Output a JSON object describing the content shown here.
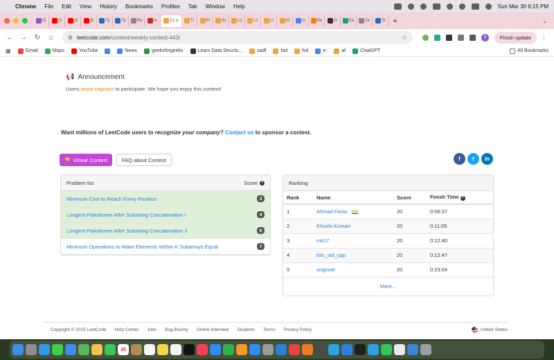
{
  "menubar": {
    "app": "Chrome",
    "items": [
      "File",
      "Edit",
      "View",
      "History",
      "Bookmarks",
      "Profiles",
      "Tab",
      "Window",
      "Help"
    ],
    "clock": "Sun Mar 30  6:15 PM"
  },
  "tabs": [
    {
      "label": "Gi",
      "color": "#7b5cd6"
    },
    {
      "label": "(3",
      "color": "#ff0000"
    },
    {
      "label": "(6",
      "color": "#ff0000"
    },
    {
      "label": "(6",
      "color": "#ff0000"
    },
    {
      "label": "Ty",
      "color": "#1f6fb2"
    },
    {
      "label": "Ty",
      "color": "#1f6fb2"
    },
    {
      "label": "Re",
      "color": "#888888"
    },
    {
      "label": "m",
      "color": "#c62828"
    },
    {
      "label": "Cc",
      "color": "#f0a23b",
      "active": true
    },
    {
      "label": "Tl",
      "color": "#f0a23b"
    },
    {
      "label": "Pr",
      "color": "#f0a23b"
    },
    {
      "label": "Sc",
      "color": "#f0a23b"
    },
    {
      "label": "Lc",
      "color": "#f0a23b"
    },
    {
      "label": "Lc",
      "color": "#f0a23b"
    },
    {
      "label": "Lt",
      "color": "#f0a23b"
    },
    {
      "label": "M",
      "color": "#f0a23b"
    },
    {
      "label": "In",
      "color": "#4285f4"
    },
    {
      "label": "Re",
      "color": "#f57c00"
    },
    {
      "label": "G",
      "color": "#333333"
    },
    {
      "label": "Ea",
      "color": "#10a37f"
    },
    {
      "label": "Ze",
      "color": "#888888"
    },
    {
      "label": "Sl",
      "color": "#1f6fb2"
    }
  ],
  "address": {
    "host": "leetcode.com",
    "path": "/contest/weekly-contest-443/"
  },
  "toolbar": {
    "finish_update": "Finish update"
  },
  "bookmarks": [
    {
      "label": "Gmail",
      "color": "#ea4335"
    },
    {
      "label": "Maps",
      "color": "#34a853"
    },
    {
      "label": "YouTube",
      "color": "#ff0000"
    },
    {
      "label": "",
      "color": "#4285f4"
    },
    {
      "label": "News",
      "color": "#4285f4"
    },
    {
      "label": "geeksforgeeks",
      "color": "#2f8d46"
    },
    {
      "label": "Learn Data Structu...",
      "color": "#333333"
    },
    {
      "label": "sadf",
      "color": "#f0a23b"
    },
    {
      "label": "fad",
      "color": "#f0a23b"
    },
    {
      "label": "fsd",
      "color": "#f0a23b"
    },
    {
      "label": "e;",
      "color": "#4285f4"
    },
    {
      "label": "af",
      "color": "#f0a23b"
    },
    {
      "label": "ChatGPT",
      "color": "#10a37f"
    }
  ],
  "all_bookmarks": "All Bookmarks",
  "announcement": {
    "title": "Announcement",
    "text_before": "Users ",
    "link": "must register",
    "text_after": " to participate. We hope you enjoy this contest!"
  },
  "sponsor": {
    "part1": "Want millions of LeetCode users to ",
    "emph": "recognize your company",
    "part2": "? ",
    "link": "Contact us",
    "part3": " to sponsor a contest."
  },
  "buttons": {
    "virtual_em": "Virtual",
    "virtual_rest": " Contest",
    "faq": "FAQ about Contest"
  },
  "social": [
    {
      "icon": "f",
      "color": "#3b5998"
    },
    {
      "icon": "t",
      "color": "#1da1f2"
    },
    {
      "icon": "in",
      "color": "#0077b5"
    }
  ],
  "problem_list": {
    "header": "Problem list",
    "score_header": "Score",
    "items": [
      {
        "title": "Minimum Cost to Reach Every Position",
        "score": "3",
        "solved": true
      },
      {
        "title": "Longest Palindrome After Substring Concatenation I",
        "score": "4",
        "solved": true
      },
      {
        "title": "Longest Palindrome After Substring Concatenation II",
        "score": "6",
        "solved": true
      },
      {
        "title": "Minimum Operations to Make Elements Within K Subarrays Equal",
        "score": "7",
        "solved": false
      }
    ]
  },
  "ranking": {
    "header": "Ranking",
    "columns": [
      "Rank",
      "Name",
      "Score",
      "Finish Time"
    ],
    "rows": [
      {
        "rank": "1",
        "name": "Ahmad Faraz",
        "score": "20",
        "time": "0:06:37",
        "flag": true
      },
      {
        "rank": "2",
        "name": "Khushi Kumari",
        "score": "20",
        "time": "0:11:05",
        "flag": false
      },
      {
        "rank": "3",
        "name": "mk17",
        "score": "20",
        "time": "0:12:40",
        "flag": false
      },
      {
        "rank": "4",
        "name": "bits_std_cpp",
        "score": "20",
        "time": "0:12:47",
        "flag": false
      },
      {
        "rank": "5",
        "name": "arignote",
        "score": "20",
        "time": "0:23:04",
        "flag": false
      }
    ],
    "more": "More..."
  },
  "footer": {
    "links": [
      "Copyright © 2025 LeetCode",
      "Help Center",
      "Jobs",
      "Bug Bounty",
      "Online Interview",
      "Students",
      "Terms",
      "Privacy Policy"
    ],
    "region": "United States"
  },
  "dock": [
    {
      "name": "finder",
      "color": "#3d8ee6"
    },
    {
      "name": "launchpad",
      "color": "#8f8f8f"
    },
    {
      "name": "safari",
      "color": "#2f9ae8"
    },
    {
      "name": "messages",
      "color": "#3ccf4e"
    },
    {
      "name": "mail",
      "color": "#3f8ef2"
    },
    {
      "name": "maps",
      "color": "#58b85b"
    },
    {
      "name": "photos",
      "color": "#f2c14e"
    },
    {
      "name": "facetime",
      "color": "#37c857"
    },
    {
      "name": "calendar",
      "color": "#ffffff",
      "label": "30"
    },
    {
      "name": "contacts",
      "color": "#b08a5a"
    },
    {
      "name": "reminders",
      "color": "#f5f5f5"
    },
    {
      "name": "notes",
      "color": "#f7d54a"
    },
    {
      "name": "freeform",
      "color": "#f5f5f5"
    },
    {
      "name": "tv",
      "color": "#111111"
    },
    {
      "name": "music",
      "color": "#fa3f56"
    },
    {
      "name": "keynote",
      "color": "#2d8ef0"
    },
    {
      "name": "numbers",
      "color": "#2fb44a"
    },
    {
      "name": "pages",
      "color": "#f39a2b"
    },
    {
      "name": "app-store",
      "color": "#2f8ef0"
    },
    {
      "name": "settings",
      "color": "#9a9a9a"
    },
    {
      "name": "vscode",
      "color": "#2b7fd4"
    },
    {
      "name": "chrome",
      "color": "#e8453c"
    },
    {
      "name": "firefox",
      "color": "#f07a24"
    },
    {
      "name": "simulator",
      "color": "#4a4a4a"
    },
    {
      "name": "telegram",
      "color": "#2aa3e0"
    },
    {
      "name": "xcode",
      "color": "#2f7fe0"
    },
    {
      "name": "terminal",
      "color": "#1e1e1e"
    },
    {
      "name": "skype",
      "color": "#2ea2e0"
    },
    {
      "name": "whatsapp",
      "color": "#33c55a"
    },
    {
      "name": "preview",
      "color": "#e9e9e9"
    },
    {
      "name": "downloads",
      "color": "#3f83d6"
    },
    {
      "name": "trash",
      "color": "#9aa0a6"
    }
  ]
}
